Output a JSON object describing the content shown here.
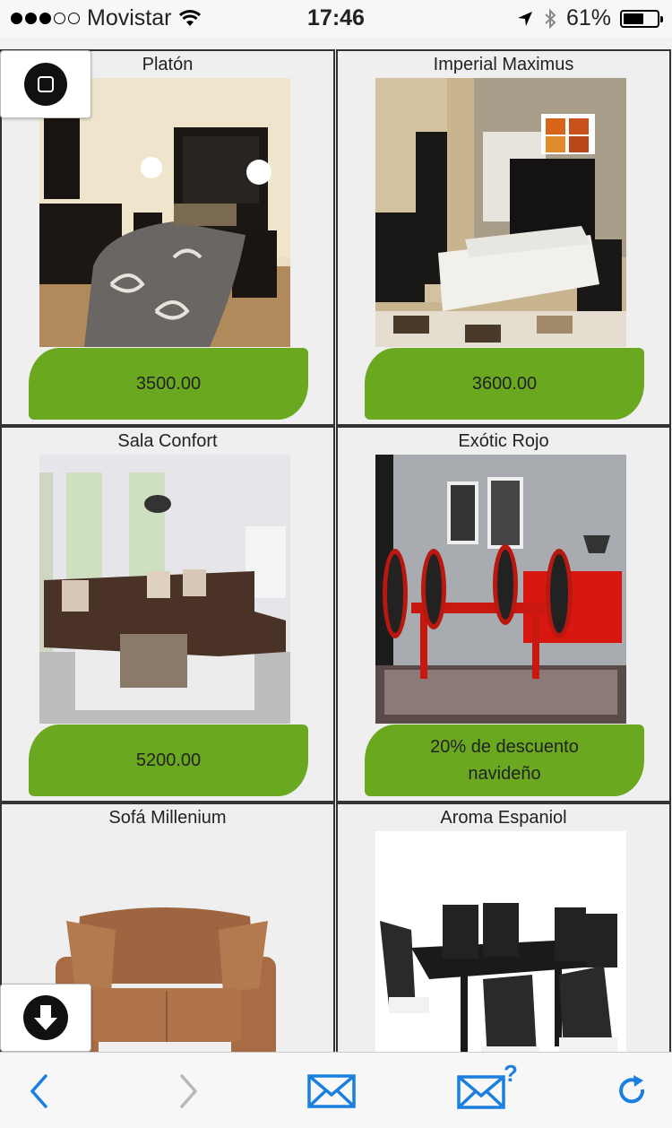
{
  "status_bar": {
    "carrier": "Movistar",
    "time": "17:46",
    "battery": "61%",
    "battery_level": 0.61,
    "signal_bars_filled": 3,
    "signal_bars_total": 5
  },
  "products": [
    {
      "name": "Platón",
      "price": "3500.00"
    },
    {
      "name": "Imperial Maximus",
      "price": "3600.00"
    },
    {
      "name": "Sala Confort",
      "price": "5200.00"
    },
    {
      "name": "Exótic Rojo",
      "price": "20% de descuento navideño"
    },
    {
      "name": "Sofá Millenium"
    },
    {
      "name": "Aroma Espaniol"
    }
  ],
  "colors": {
    "price_badge": "#6aa820",
    "toolbar_accent": "#1a7fe0"
  },
  "icons": {
    "home": "home-button-icon",
    "download": "download-icon",
    "back": "back-chevron-icon",
    "forward": "forward-chevron-icon",
    "mail": "mail-icon",
    "mail_question": "mail-question-icon",
    "refresh": "refresh-icon"
  },
  "toolbar": {
    "mail_question_mark": "?"
  }
}
